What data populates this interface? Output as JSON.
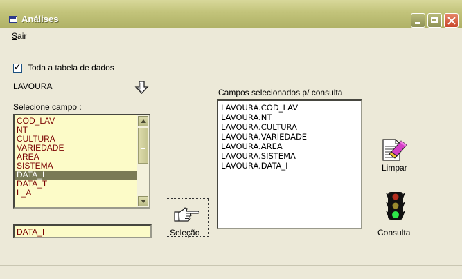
{
  "window": {
    "title": "Análises"
  },
  "menu": {
    "sair_underline": "S",
    "sair_rest": "air"
  },
  "options": {
    "whole_table_label": "Toda a tabela de dados",
    "whole_table_checked": true
  },
  "table_name": "LAVOURA",
  "field_list": {
    "label": "Selecione campo :",
    "items": [
      "COD_LAV",
      "NT",
      "CULTURA",
      "VARIEDADE",
      "AREA",
      "SISTEMA",
      "DATA_I",
      "DATA_T",
      "L_A"
    ],
    "selected": "DATA_I"
  },
  "selected_field_value": "DATA_I",
  "buttons": {
    "selecao": "Seleção",
    "limpar": "Limpar",
    "consulta": "Consulta"
  },
  "selected_fields": {
    "label": "Campos selecionados p/ consulta",
    "items": [
      "LAVOURA.COD_LAV",
      "LAVOURA.NT",
      "LAVOURA.CULTURA",
      "LAVOURA.VARIEDADE",
      "LAVOURA.AREA",
      "LAVOURA.SISTEMA",
      "LAVOURA.DATA_I"
    ]
  },
  "icons": {
    "app": "window-icon",
    "down": "down-arrow-icon",
    "hand": "pointing-hand-icon",
    "limpar": "eraser-document-icon",
    "consulta": "traffic-light-icon"
  },
  "colors": {
    "titlebar": "#c2c37a",
    "list_bg": "#fcfbc8",
    "list_text": "#7a0000",
    "selection": "#7a7a56"
  }
}
